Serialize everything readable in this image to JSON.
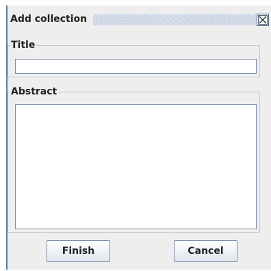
{
  "dialog": {
    "title": "Add collection",
    "close_icon": "close-icon"
  },
  "title_section": {
    "label": "Title",
    "value": "",
    "placeholder": ""
  },
  "abstract_section": {
    "label": "Abstract",
    "value": "",
    "placeholder": ""
  },
  "buttons": {
    "finish_label": "Finish",
    "cancel_label": "Cancel"
  },
  "colors": {
    "window_border": "#5d7fa6",
    "field_border": "#7a8ea8",
    "background": "#eeeeee"
  }
}
